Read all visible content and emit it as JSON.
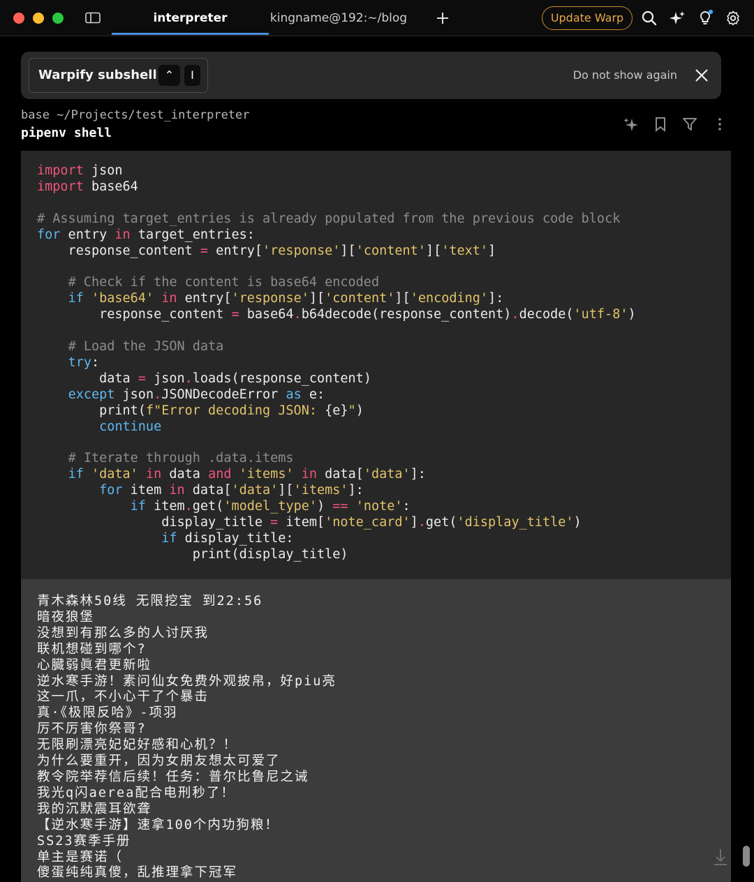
{
  "titlebar": {
    "tabs": [
      {
        "label": "interpreter",
        "active": true
      },
      {
        "label": "kingname@192:~/blog",
        "active": false
      }
    ],
    "update_label": "Update Warp",
    "icons": [
      "panel-icon",
      "plus-icon",
      "search-icon",
      "sparkle-icon",
      "lightbulb-icon",
      "gear-icon"
    ],
    "colors": {
      "accent": "#4a8fe0",
      "update": "#e9a84a",
      "notify_dot": "#3ba7f5"
    }
  },
  "banner": {
    "warpify_label": "Warpify subshell",
    "key1": "⌃",
    "key2": "I",
    "dismiss_label": "Do not show again"
  },
  "block": {
    "path": "base ~/Projects/test_interpreter",
    "command": "pipenv shell"
  },
  "output_lines": [
    "青木森林50线 无限挖宝 到22:56",
    "暗夜狼堡",
    "没想到有那么多的人讨厌我",
    "联机想碰到哪个?",
    "心臓弱眞君更新啦",
    "逆水寒手游！素问仙女免费外观披帛，好piu亮",
    "这一爪，不小心干了个暴击",
    "真·《极限反哈》-项羽",
    "厉不厉害你祭哥?",
    "无限刷漂亮妃妃好感和心机？！",
    "为什么要重开，因为女朋友想太可爱了",
    "教令院举荐信后续！任务：普尔比鲁尼之诫",
    "我光q闪aerea配合电刑秒了！",
    "我的沉默震耳欲聋",
    "【逆水寒手游】速拿100个内功狗粮！",
    "SS23赛季手册",
    "单主是赛诺（",
    "傻蛋纯纯真傻，乱推理拿下冠军"
  ]
}
